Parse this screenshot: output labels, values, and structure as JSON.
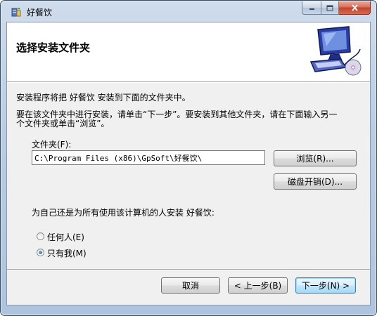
{
  "window": {
    "title": "好餐饮"
  },
  "banner": {
    "title": "选择安装文件夹",
    "art_icon": "computer-setup-icon"
  },
  "body": {
    "intro": "安装程序将把 好餐饮 安装到下面的文件夹中。",
    "instructions_line1": "要在该文件夹中进行安装，请单击“下一步”。要安装到其他文件夹，请在下面输入另一",
    "instructions_line2": "个文件夹或单击“浏览”。"
  },
  "folder": {
    "label": "文件夹(F):",
    "value": "C:\\Program Files (x86)\\GpSoft\\好餐饮\\",
    "browse_label": "浏览(R)...",
    "disk_cost_label": "磁盘开销(D)..."
  },
  "install_for": {
    "question": "为自己还是为所有使用该计算机的人安装 好餐饮:",
    "options": [
      {
        "label": "任何人(E)",
        "checked": false
      },
      {
        "label": "只有我(M)",
        "checked": true
      }
    ]
  },
  "footer": {
    "cancel_label": "取消",
    "back_label": "< 上一步(B)",
    "next_label": "下一步(N) >"
  },
  "colors": {
    "client_bg": "#f0f0f0",
    "frame": "#b9cde4",
    "close_button": "#c4412a"
  }
}
